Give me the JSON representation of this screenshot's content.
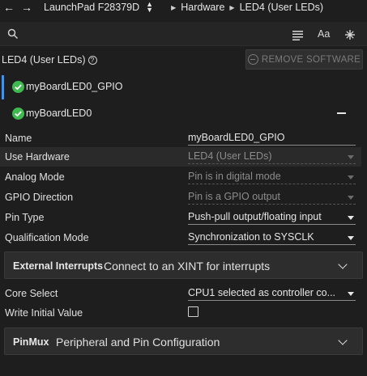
{
  "topbar": {
    "board": "LaunchPad F28379D",
    "crumb1": "Hardware",
    "crumb2": "LED4 (User LEDs)"
  },
  "search": {
    "placeholder": "",
    "value": ""
  },
  "toolbar": {
    "font_label": "Aa"
  },
  "header": {
    "title": "LED4 (User LEDs)",
    "help": "?",
    "remove_label": "REMOVE SOFTWARE"
  },
  "tree": [
    {
      "label": "myBoardLED0_GPIO"
    },
    {
      "label": "myBoardLED0"
    }
  ],
  "properties": {
    "name": {
      "label": "Name",
      "value": "myBoardLED0_GPIO"
    },
    "use_hardware": {
      "label": "Use Hardware",
      "value": "LED4 (User LEDs)"
    },
    "analog_mode": {
      "label": "Analog Mode",
      "value": "Pin is in digital mode"
    },
    "gpio_direction": {
      "label": "GPIO Direction",
      "value": "Pin is a GPIO output"
    },
    "pin_type": {
      "label": "Pin Type",
      "value": "Push-pull output/floating input"
    },
    "qualification_mode": {
      "label": "Qualification Mode",
      "value": "Synchronization to SYSCLK"
    },
    "core_select": {
      "label": "Core Select",
      "value": "CPU1 selected as controller co..."
    },
    "write_initial": {
      "label": "Write Initial Value"
    }
  },
  "sections": {
    "external_interrupts": {
      "title": "External Interrupts",
      "desc": "Connect to an XINT for interrupts"
    },
    "pinmux": {
      "title": "PinMux",
      "desc": "Peripheral and Pin Configuration"
    }
  },
  "colors": {
    "accent": "#3794ff",
    "check": "#3fb950",
    "background": "#1e1e1e"
  }
}
